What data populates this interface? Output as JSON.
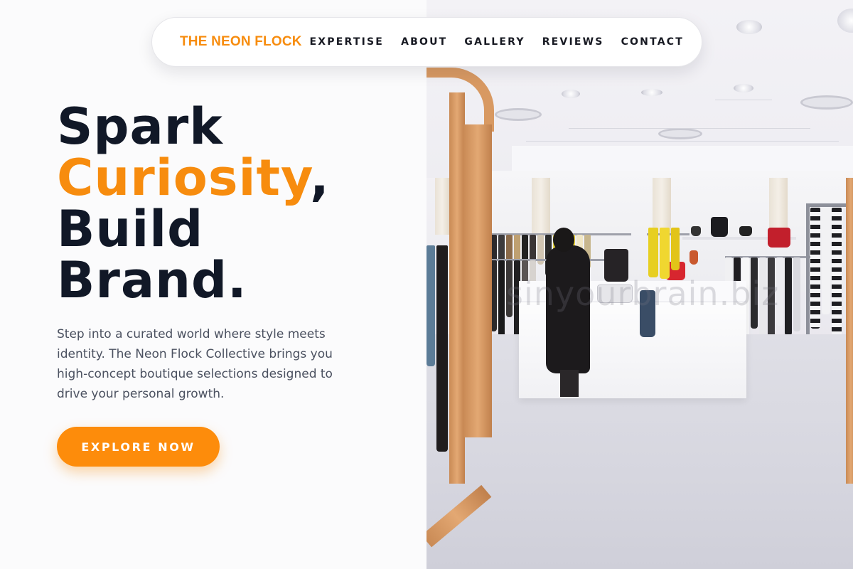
{
  "nav": {
    "brand": "THE NEON FLOCK",
    "links": [
      "EXPERTISE",
      "ABOUT",
      "GALLERY",
      "REVIEWS",
      "CONTACT"
    ]
  },
  "hero": {
    "title_line1": "Spark",
    "title_accent": "Curiosity",
    "title_comma": ",",
    "title_line3": "Build",
    "title_line4": "Brand.",
    "description": "Step into a curated world where style meets identity. The Neon Flock Collective brings you high-concept boutique selections designed to drive your personal growth.",
    "cta_label": "EXPLORE NOW"
  },
  "photo": {
    "watermark": "sinyourbrain.biz"
  },
  "colors": {
    "accent": "#f78c0e",
    "heading": "#111827",
    "body_text": "#4b5160",
    "background": "#fbfbfc"
  }
}
